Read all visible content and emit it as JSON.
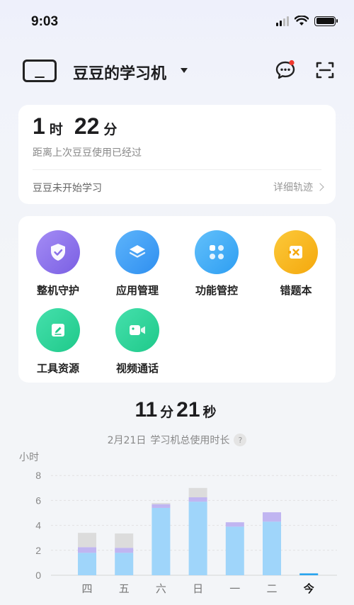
{
  "status": {
    "time": "9:03"
  },
  "header": {
    "device_name": "豆豆的学习机"
  },
  "last_use": {
    "hours": "1",
    "hours_unit": "时",
    "minutes": "22",
    "minutes_unit": "分",
    "caption": "距离上次豆豆使用已经过",
    "study_status": "豆豆未开始学习",
    "detail_link": "详细轨迹"
  },
  "features": [
    {
      "label": "整机守护",
      "icon": "shield-check-icon",
      "color": "#8f74ea"
    },
    {
      "label": "应用管理",
      "icon": "layers-icon",
      "color": "#3f9ef5"
    },
    {
      "label": "功能管控",
      "icon": "grid-dots-icon",
      "color": "#3eaaf4"
    },
    {
      "label": "错题本",
      "icon": "error-book-icon",
      "color": "#f7b81a"
    },
    {
      "label": "工具资源",
      "icon": "edit-icon",
      "color": "#2fd59a"
    },
    {
      "label": "视频通话",
      "icon": "video-call-icon",
      "color": "#2fd59a"
    }
  ],
  "usage": {
    "hours": "11",
    "hours_unit": "分",
    "minutes": "21",
    "minutes_unit": "秒",
    "date": "2月21日",
    "caption": "学习机总使用时长",
    "help": "?"
  },
  "colors": {
    "base": "#9fd5fa",
    "mid": "#c0b5f1",
    "top": "#dcdcdc",
    "today": "#2aa4ee"
  },
  "chart_data": {
    "type": "bar",
    "ylabel": "小时",
    "ylim": [
      0,
      8
    ],
    "yticks": [
      "8",
      "6",
      "4",
      "2",
      "0"
    ],
    "categories": [
      "四",
      "五",
      "六",
      "日",
      "一",
      "二",
      "今"
    ],
    "series": [
      {
        "values": [
          1.8,
          1.8,
          5.4,
          5.9,
          3.9,
          4.3,
          0.15
        ]
      },
      {
        "values": [
          0.45,
          0.4,
          0.3,
          0.35,
          0.35,
          0.75,
          0
        ]
      },
      {
        "values": [
          1.15,
          1.15,
          0.1,
          0.75,
          0,
          0,
          0
        ]
      }
    ]
  }
}
